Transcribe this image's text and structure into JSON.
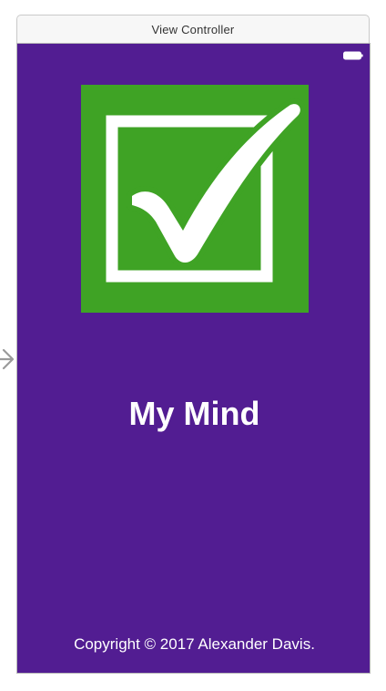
{
  "scene": {
    "title": "View Controller",
    "entry_arrow_icon": "entry-point-arrow-icon"
  },
  "screen": {
    "background_color": "#521d92",
    "status_bar": {
      "battery_icon": "battery-icon"
    },
    "logo": {
      "icon": "checkbox-checkmark-icon",
      "background_color": "#3fa325",
      "mark_color": "#ffffff"
    },
    "app_title": "My Mind",
    "copyright": "Copyright © 2017 Alexander Davis."
  }
}
